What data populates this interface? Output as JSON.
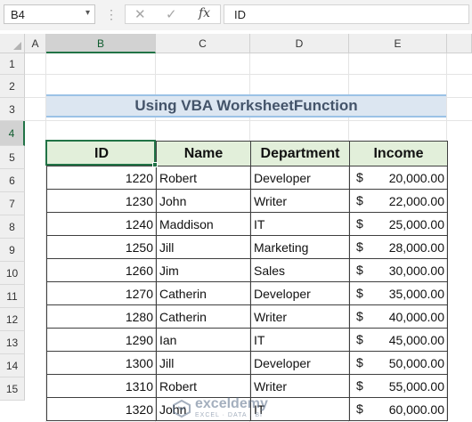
{
  "formula_bar": {
    "name_box": "B4",
    "name_box_arrow": "▾",
    "dots": "⋮",
    "cancel_glyph": "✕",
    "enter_glyph": "✓",
    "fx_label": "fx",
    "formula": "ID"
  },
  "columns": [
    {
      "label": "A"
    },
    {
      "label": "B"
    },
    {
      "label": "C"
    },
    {
      "label": "D"
    },
    {
      "label": "E"
    }
  ],
  "rows": [
    {
      "label": "1"
    },
    {
      "label": "2"
    },
    {
      "label": "3"
    },
    {
      "label": "4"
    },
    {
      "label": "5"
    },
    {
      "label": "6"
    },
    {
      "label": "7"
    },
    {
      "label": "8"
    },
    {
      "label": "9"
    },
    {
      "label": "10"
    },
    {
      "label": "11"
    },
    {
      "label": "12"
    },
    {
      "label": "13"
    },
    {
      "label": "14"
    },
    {
      "label": "15"
    }
  ],
  "selection": {
    "column": "B",
    "row": "4"
  },
  "sheet_title": "Using VBA WorksheetFunction",
  "table": {
    "headers": [
      "ID",
      "Name",
      "Department",
      "Income"
    ],
    "currency_symbol": "$",
    "rows": [
      {
        "id": "1220",
        "name": "Robert",
        "department": "Developer",
        "income": "20,000.00"
      },
      {
        "id": "1230",
        "name": "John",
        "department": "Writer",
        "income": "22,000.00"
      },
      {
        "id": "1240",
        "name": "Maddison",
        "department": "IT",
        "income": "25,000.00"
      },
      {
        "id": "1250",
        "name": "Jill",
        "department": "Marketing",
        "income": "28,000.00"
      },
      {
        "id": "1260",
        "name": "Jim",
        "department": "Sales",
        "income": "30,000.00"
      },
      {
        "id": "1270",
        "name": "Catherin",
        "department": "Developer",
        "income": "35,000.00"
      },
      {
        "id": "1280",
        "name": "Catherin",
        "department": "Writer",
        "income": "40,000.00"
      },
      {
        "id": "1290",
        "name": "Ian",
        "department": "IT",
        "income": "45,000.00"
      },
      {
        "id": "1300",
        "name": "Jill",
        "department": "Developer",
        "income": "50,000.00"
      },
      {
        "id": "1310",
        "name": "Robert",
        "department": "Writer",
        "income": "55,000.00"
      },
      {
        "id": "1320",
        "name": "John",
        "department": "IT",
        "income": "60,000.00"
      }
    ]
  },
  "watermark": {
    "name": "exceldemy",
    "tagline": "EXCEL · DATA · BI"
  },
  "colors": {
    "excel_green": "#217346",
    "header_fill": "#e2efda",
    "title_fill": "#dce6f1",
    "title_text": "#44546a"
  }
}
